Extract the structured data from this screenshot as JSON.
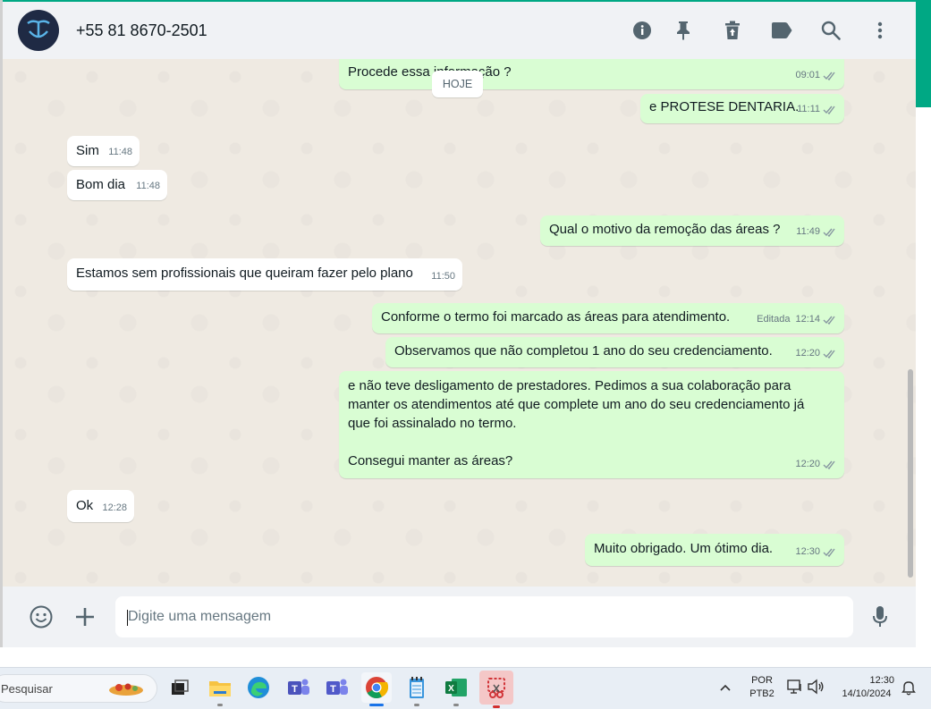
{
  "header": {
    "contact_name": "+55 81 8670-2501"
  },
  "header_icons": [
    "info-icon",
    "pin-icon",
    "delete-icon",
    "label-icon",
    "search-icon",
    "menu-icon"
  ],
  "chat": {
    "date_separator": "HOJE",
    "messages": [
      {
        "dir": "out",
        "text": "Procede essa informação ?",
        "time": "09:01",
        "status": "read"
      },
      {
        "dir": "out",
        "text": "e PROTESE DENTARIA.",
        "time": "11:11",
        "status": "read"
      },
      {
        "dir": "in",
        "text": "Sim",
        "time": "11:48"
      },
      {
        "dir": "in",
        "text": "Bom dia",
        "time": "11:48"
      },
      {
        "dir": "out",
        "text": "Qual o motivo da remoção das áreas ?",
        "time": "11:49",
        "status": "read"
      },
      {
        "dir": "in",
        "text": "Estamos sem profissionais que queiram fazer pelo plano",
        "time": "11:50"
      },
      {
        "dir": "out",
        "text": "Conforme o termo foi marcado as áreas para atendimento.",
        "time": "12:14",
        "edited": "Editada",
        "status": "read"
      },
      {
        "dir": "out",
        "text": "Observamos que não completou 1 ano do seu credenciamento.",
        "time": "12:20",
        "status": "read"
      },
      {
        "dir": "out",
        "lines": [
          "e não teve desligamento de prestadores. Pedimos a sua colaboração para",
          "manter os atendimentos até que complete um ano do seu credenciamento já",
          "que foi assinalado no termo.",
          "",
          "Consegui manter as áreas?"
        ],
        "time": "12:20",
        "status": "read"
      },
      {
        "dir": "in",
        "text": "Ok",
        "time": "12:28"
      },
      {
        "dir": "out",
        "text": "Muito obrigado. Um ótimo dia.",
        "time": "12:30",
        "status": "read"
      }
    ]
  },
  "footer": {
    "placeholder": "Digite uma mensagem"
  },
  "colors": {
    "accent": "#00a884",
    "outgoing_bubble": "#d9fdd3",
    "incoming_bubble": "#ffffff",
    "read_check": "#53bdeb"
  },
  "taskbar": {
    "search_placeholder": "Pesquisar",
    "apps": [
      "task-view",
      "file-explorer",
      "edge",
      "teams-work",
      "teams",
      "chrome",
      "notepad",
      "excel",
      "snipping-tool"
    ],
    "language": "POR",
    "layout": "PTB2",
    "time": "12:30",
    "date": "14/10/2024"
  }
}
